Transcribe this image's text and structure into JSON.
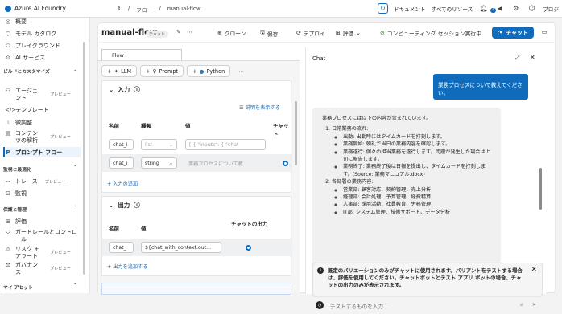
{
  "topbar": {
    "brand": "Azure AI Foundry",
    "crumb1": "フロー",
    "crumb2": "manual-flow",
    "docs": "ドキュメント",
    "resources": "すべてのリソース",
    "badge": "4",
    "user": "プロジ"
  },
  "sidebar": {
    "items": [
      "概要",
      "モデル カタログ",
      "プレイグラウンド",
      "AI サービス"
    ],
    "section_build": "ビルドとカスタマイズ",
    "agent_label": "エージェント",
    "preview": "プレビュー",
    "template": "テンプレート",
    "finetune": "微調整",
    "content_label": "コンテンツの解析",
    "promptflow": "プロンプト フロー",
    "section_eval": "監視と最適化",
    "trace": "トレース",
    "monitor": "監視",
    "section_protect": "保護と管理",
    "evaluate": "評価",
    "guard": "ガードレールとコントロール",
    "risk": "リスク + アラート",
    "gov": "ガバナンス",
    "myassets": "マイ アセット"
  },
  "flow": {
    "title": "manual-flow",
    "chip": "チャット",
    "clone": "クローン",
    "save": "保存",
    "deploy": "デプロイ",
    "evaluate": "評価",
    "compute": "コンピューティング セッション実行中",
    "chat": "チャット",
    "tab": "Flow",
    "tools": [
      "LLM",
      "Prompt",
      "Python"
    ],
    "input_title": "入力",
    "show_desc": "説明を表示する",
    "col_name": "名前",
    "col_type": "種類",
    "col_value": "値",
    "col_chat": "チャット",
    "row1": {
      "name": "chat_i",
      "type": "list",
      "value": "[  { \"inputs\": {   \"chat"
    },
    "row2": {
      "name": "chat_i",
      "type": "string",
      "value": "業務プロセスについて教"
    },
    "add_input": "入力の追加",
    "output_title": "出力",
    "out_col_name": "名前",
    "out_col_value": "値",
    "out_col_chat": "チャットの出力",
    "out_row": {
      "name": "chat_",
      "value": "${chat_with_context.out..."
    },
    "add_output": "出力を追加する"
  },
  "chat": {
    "title": "Chat",
    "user_msg": "業務プロセスについて教えてください。",
    "bot_intro": "業務プロセスには以下の内容が含まれています。",
    "s1_title": "日常業務の流れ:",
    "s1_items": [
      "出勤: 出勤時にはタイムカードを打刻します。",
      "業務開始: 朝礼で当日の業務内容を確認します。",
      "業務遂行: 個々の担当業務を遂行します。問題が発生した場合は上司に報告します。",
      "業務終了: 業務終了後は日報を提出し、タイムカードを打刻します。(Source: 業務マニュアル.docx)"
    ],
    "s2_title": "各部署の業務内容:",
    "s2_items": [
      "営業部: 顧客対応、契約管理、売上分析",
      "経理部: 会計処理、予算管理、経費精算",
      "人事部: 採用活動、社員教育、労務管理",
      "IT部: システム管理、技術サポート、データ分析"
    ],
    "notice": "既定のバリエーションのみがチャットに使用されます。バリアントをテストする場合は、評価を使用してください。チャットボットとテスト アプリ ボットの場合、チャットの出力のみが表示されます。",
    "placeholder": "テストするものを入力..."
  }
}
